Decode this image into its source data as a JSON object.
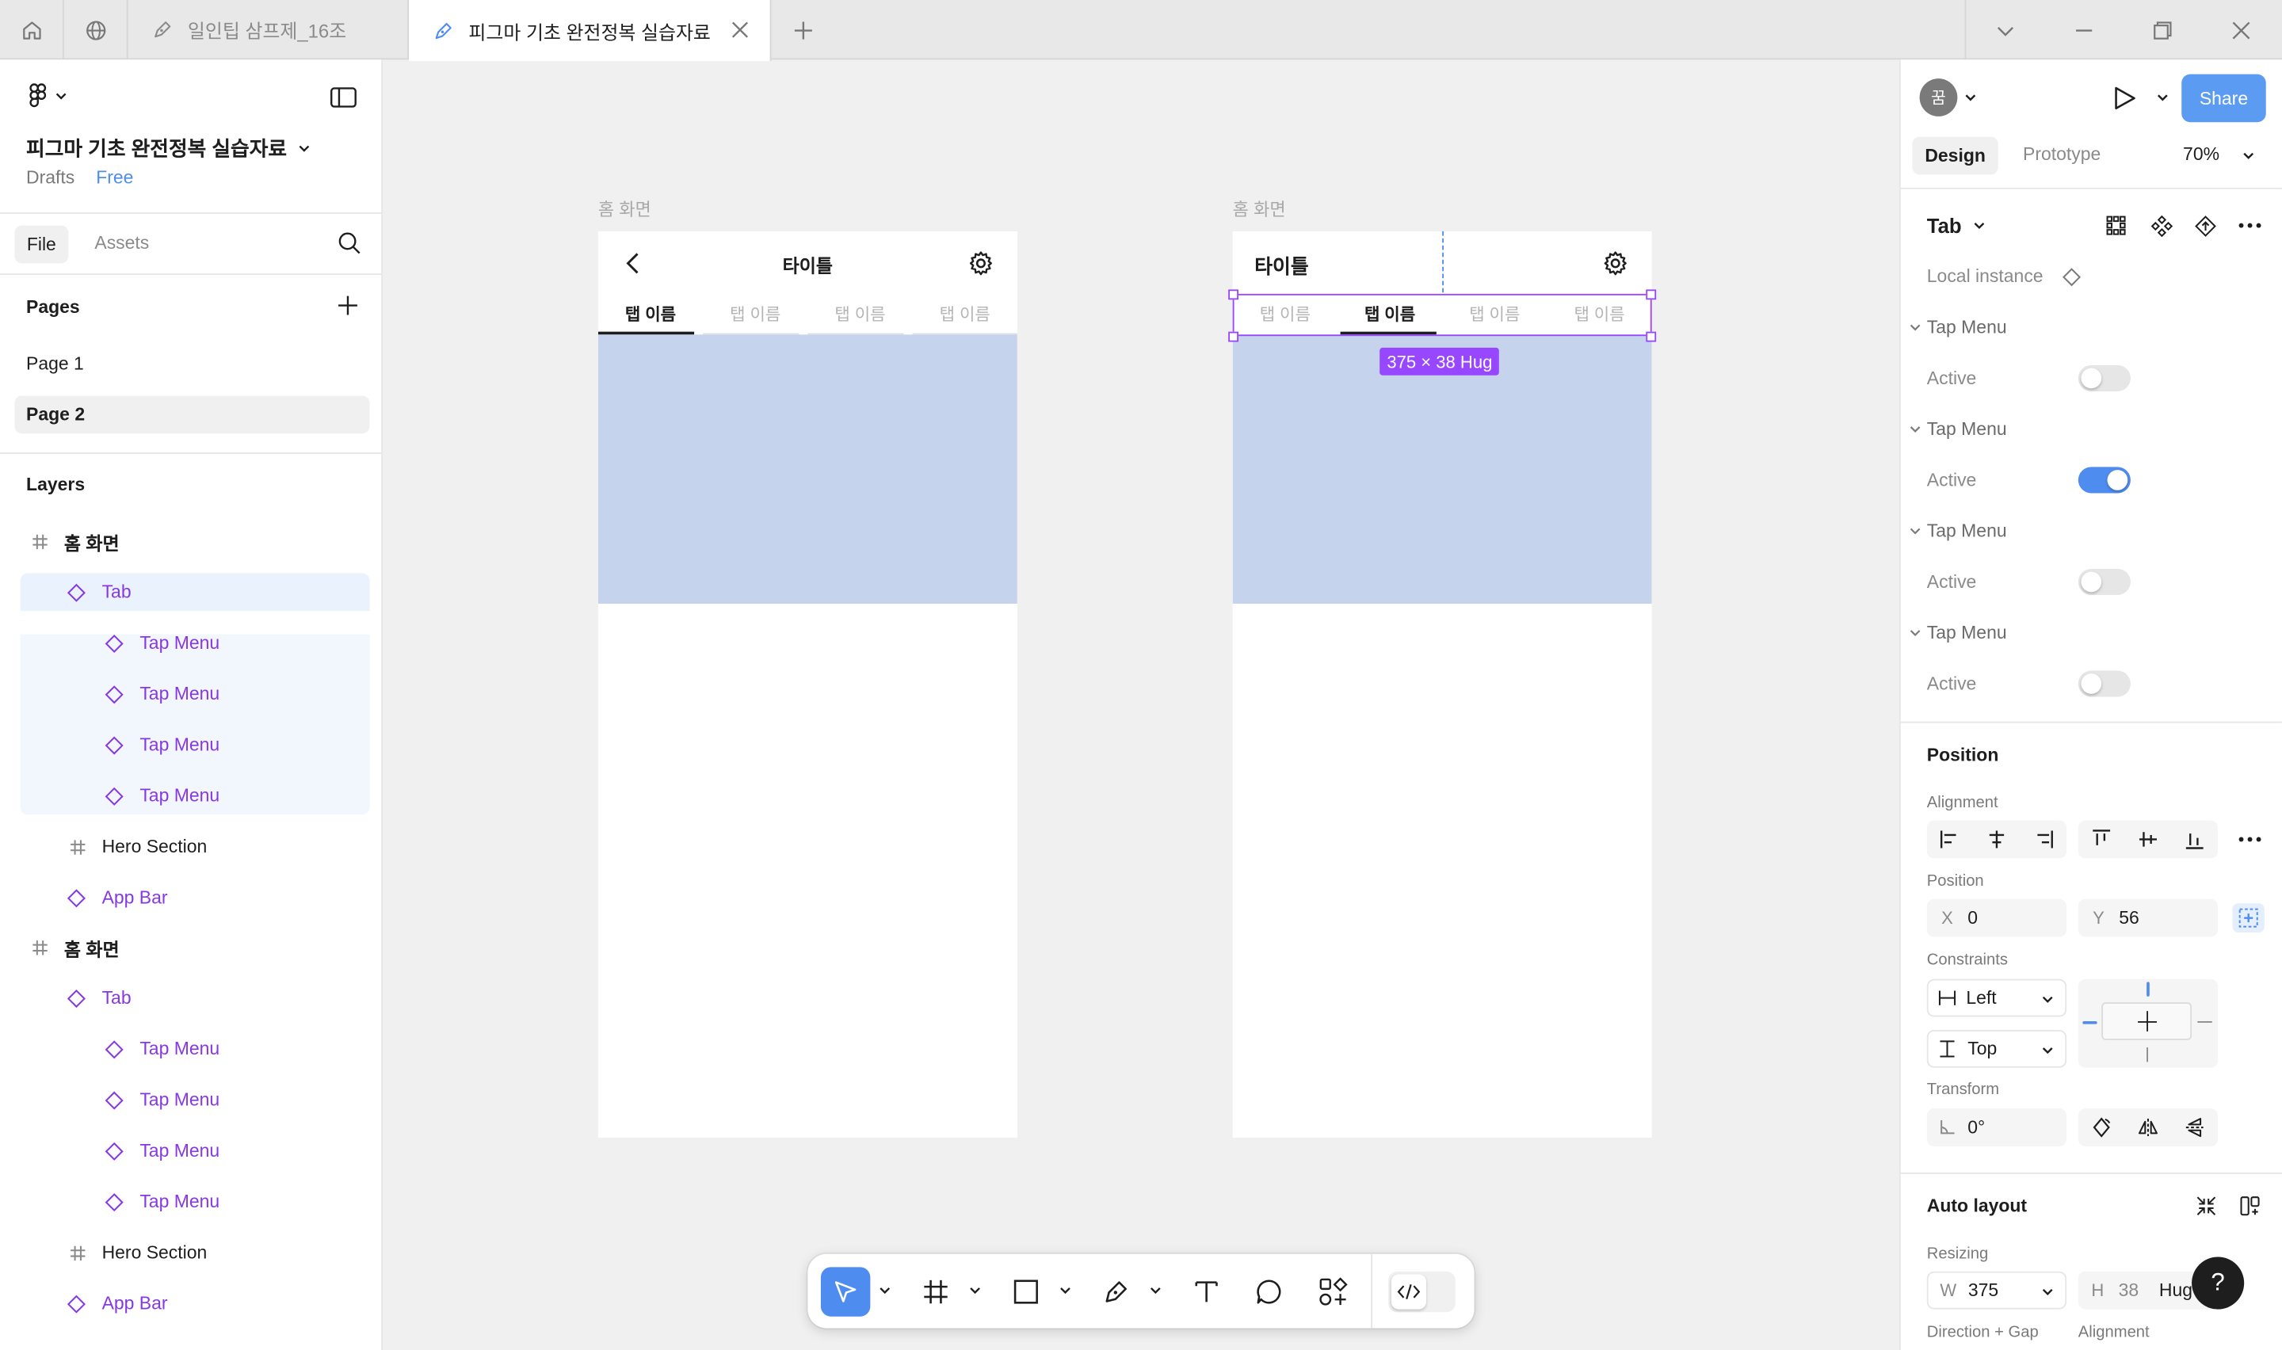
{
  "tabs": {
    "items": [
      {
        "label": "일인팁 삼프제_16조"
      },
      {
        "label": "피그마 기초 완전정복 실습자료"
      }
    ]
  },
  "file": {
    "name": "피그마 기초 완전정복 실습자료",
    "location": "Drafts",
    "plan": "Free"
  },
  "left_tabs": {
    "file": "File",
    "assets": "Assets"
  },
  "pages": {
    "header": "Pages",
    "items": [
      {
        "label": "Page 1"
      },
      {
        "label": "Page 2"
      }
    ]
  },
  "layers": {
    "header": "Layers",
    "items": [
      {
        "label": "홈 화면"
      },
      {
        "label": "Tab"
      },
      {
        "label": "Tap Menu"
      },
      {
        "label": "Tap Menu"
      },
      {
        "label": "Tap Menu"
      },
      {
        "label": "Tap Menu"
      },
      {
        "label": "Hero Section"
      },
      {
        "label": "App Bar"
      },
      {
        "label": "홈 화면"
      },
      {
        "label": "Tab"
      },
      {
        "label": "Tap Menu"
      },
      {
        "label": "Tap Menu"
      },
      {
        "label": "Tap Menu"
      },
      {
        "label": "Tap Menu"
      },
      {
        "label": "Hero Section"
      },
      {
        "label": "App Bar"
      }
    ]
  },
  "canvas": {
    "frame1": {
      "label": "홈 화면",
      "title": "타이틀",
      "tabs": [
        "탭 이름",
        "탭 이름",
        "탭 이름",
        "탭 이름"
      ]
    },
    "frame2": {
      "label": "홈 화면",
      "title": "타이틀",
      "tabs": [
        "탭 이름",
        "탭 이름",
        "탭 이름",
        "탭 이름"
      ],
      "size_badge": "375 × 38 Hug"
    }
  },
  "right": {
    "avatar_initial": "꿈",
    "share": "Share",
    "design_tab": "Design",
    "prototype_tab": "Prototype",
    "zoom": "70%",
    "component_name": "Tab",
    "local_instance": "Local instance",
    "props": [
      {
        "group": "Tap Menu",
        "prop": "Active",
        "on": false
      },
      {
        "group": "Tap Menu",
        "prop": "Active",
        "on": true
      },
      {
        "group": "Tap Menu",
        "prop": "Active",
        "on": false
      },
      {
        "group": "Tap Menu",
        "prop": "Active",
        "on": false
      }
    ],
    "position": {
      "header": "Position",
      "alignment_label": "Alignment",
      "position_label": "Position",
      "x_label": "X",
      "x": "0",
      "y_label": "Y",
      "y": "56",
      "constraints_label": "Constraints",
      "constraint_h": "Left",
      "constraint_v": "Top",
      "transform_label": "Transform",
      "rotation": "0°"
    },
    "auto_layout": {
      "header": "Auto layout",
      "resizing_label": "Resizing",
      "w_label": "W",
      "w": "375",
      "h_label": "H",
      "h": "38",
      "h_mode": "Hug",
      "direction_label": "Direction + Gap",
      "alignment_label": "Alignment"
    }
  },
  "colors": {
    "accent": "#4f8cf0",
    "component_purple": "#8638e5",
    "selection_purple": "#9747ff",
    "hero_fill": "#c6d3ec"
  }
}
